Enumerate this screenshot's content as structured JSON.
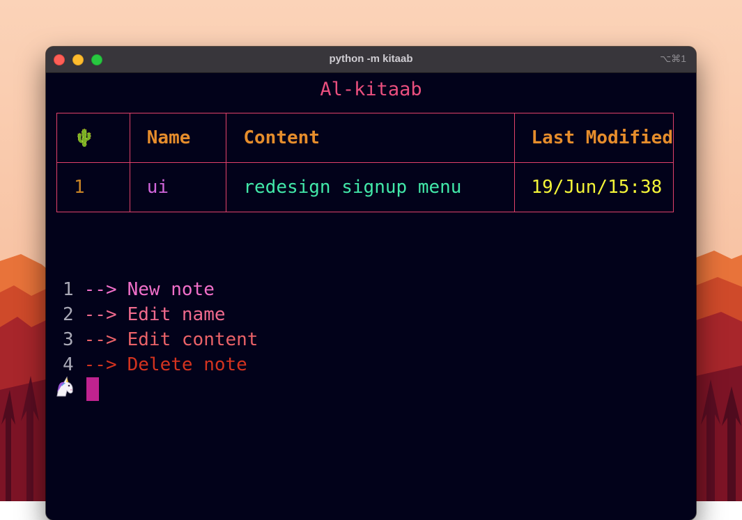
{
  "window": {
    "title": "python -m kitaab",
    "shortcut": "⌥⌘1"
  },
  "app": {
    "title": "Al-kitaab"
  },
  "table": {
    "header_icon": "cactus-icon",
    "columns": [
      "Name",
      "Content",
      "Last Modified"
    ],
    "rows": [
      {
        "id": "1",
        "name": "ui",
        "content": "redesign signup menu",
        "modified": "19/Jun/15:38"
      }
    ]
  },
  "menu": [
    {
      "num": "1",
      "arrow": "-->",
      "label": "New note"
    },
    {
      "num": "2",
      "arrow": "-->",
      "label": "Edit name"
    },
    {
      "num": "3",
      "arrow": "-->",
      "label": "Edit content"
    },
    {
      "num": "4",
      "arrow": "-->",
      "label": "Delete note"
    }
  ],
  "prompt": {
    "icon": "unicorn-icon"
  },
  "colors": {
    "background": "#02021a",
    "border": "#e2416a",
    "header": "#e68d2c",
    "cursor": "#c0238f"
  }
}
